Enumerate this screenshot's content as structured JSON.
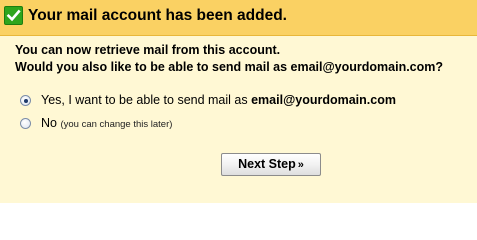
{
  "banner": {
    "title": "Your mail account has been added.",
    "icon": "checkmark-icon",
    "color": "#fad163",
    "check_color": "#2fa51c"
  },
  "message": {
    "line1": "You can now retrieve mail from this account.",
    "line2": "Would you also like to be able to send mail as email@yourdomain.com?"
  },
  "options": {
    "yes": {
      "label": "Yes, I want to be able to send mail as",
      "email": "email@yourdomain.com",
      "selected": true
    },
    "no": {
      "label": "No",
      "hint": "(you can change this later)",
      "selected": false
    }
  },
  "next_button": {
    "label": "Next Step",
    "arrow": "»"
  },
  "panel_color": "#fff8d4"
}
